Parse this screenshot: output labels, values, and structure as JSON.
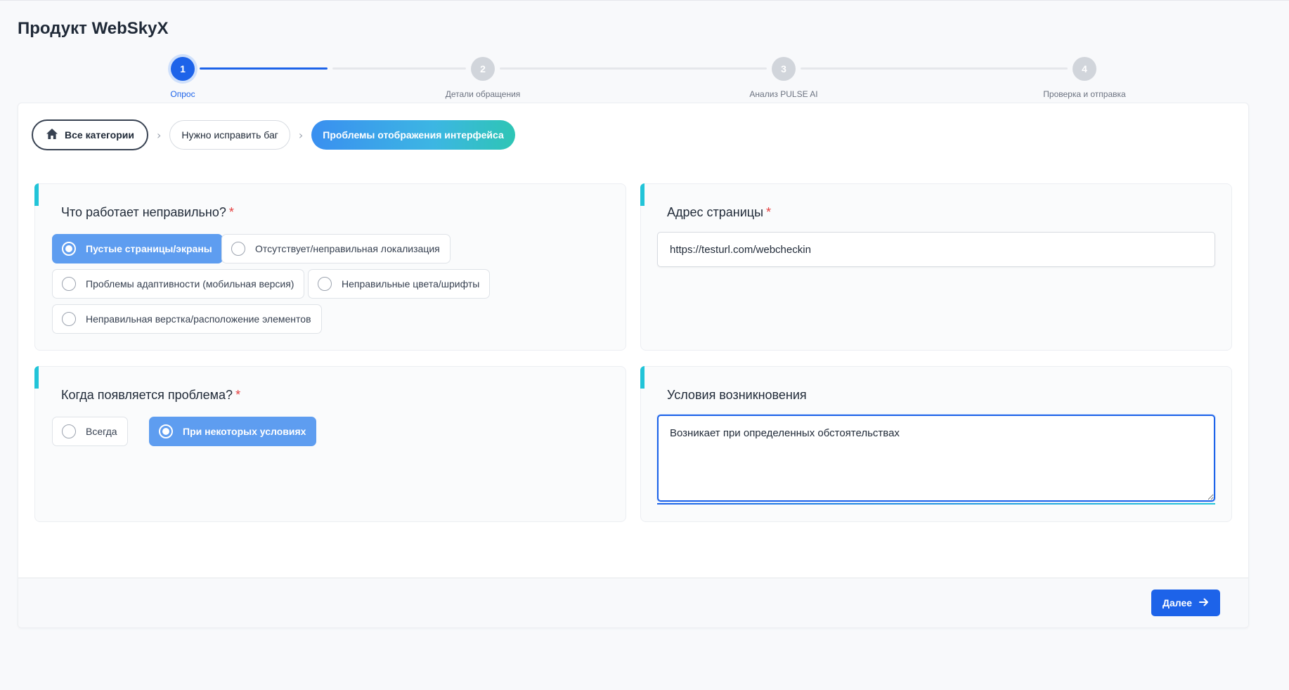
{
  "app": {
    "title": "Продукт WebSkyX"
  },
  "stepper": {
    "steps": [
      {
        "number": "1",
        "label": "Опрос",
        "active": true
      },
      {
        "number": "2",
        "label": "Детали обращения",
        "active": false
      },
      {
        "number": "3",
        "label": "Анализ PULSE AI",
        "active": false
      },
      {
        "number": "4",
        "label": "Проверка и отправка",
        "active": false
      }
    ]
  },
  "breadcrumb": {
    "home_label": "Все категории",
    "mid_label": "Нужно исправить баг",
    "active_label": "Проблемы отображения интерфейса"
  },
  "question_what": {
    "title": "Что работает неправильно?",
    "required_mark": "*",
    "options": [
      {
        "label": "Пустые страницы/экраны",
        "selected": true
      },
      {
        "label": "Отсутствует/неправильная локализация",
        "selected": false
      },
      {
        "label": "Проблемы адаптивности (мобильная версия)",
        "selected": false
      },
      {
        "label": "Неправильные цвета/шрифты",
        "selected": false
      },
      {
        "label": "Неправильная верстка/расположение элементов",
        "selected": false
      }
    ]
  },
  "page_address": {
    "title": "Адрес страницы",
    "required_mark": "*",
    "value": "https://testurl.com/webcheckin"
  },
  "question_when": {
    "title": "Когда появляется проблема?",
    "required_mark": "*",
    "options": [
      {
        "label": "Всегда",
        "selected": false
      },
      {
        "label": "При некоторых условиях",
        "selected": true
      }
    ]
  },
  "conditions": {
    "title": "Условия возникновения",
    "value": "Возникает при определенных обстоятельствах"
  },
  "footer": {
    "next_label": "Далее"
  },
  "colors": {
    "accent": "#1d63e9",
    "selected_option": "#5e9df0",
    "panel_accent": "#22c4d8",
    "required": "#e53e3e"
  }
}
